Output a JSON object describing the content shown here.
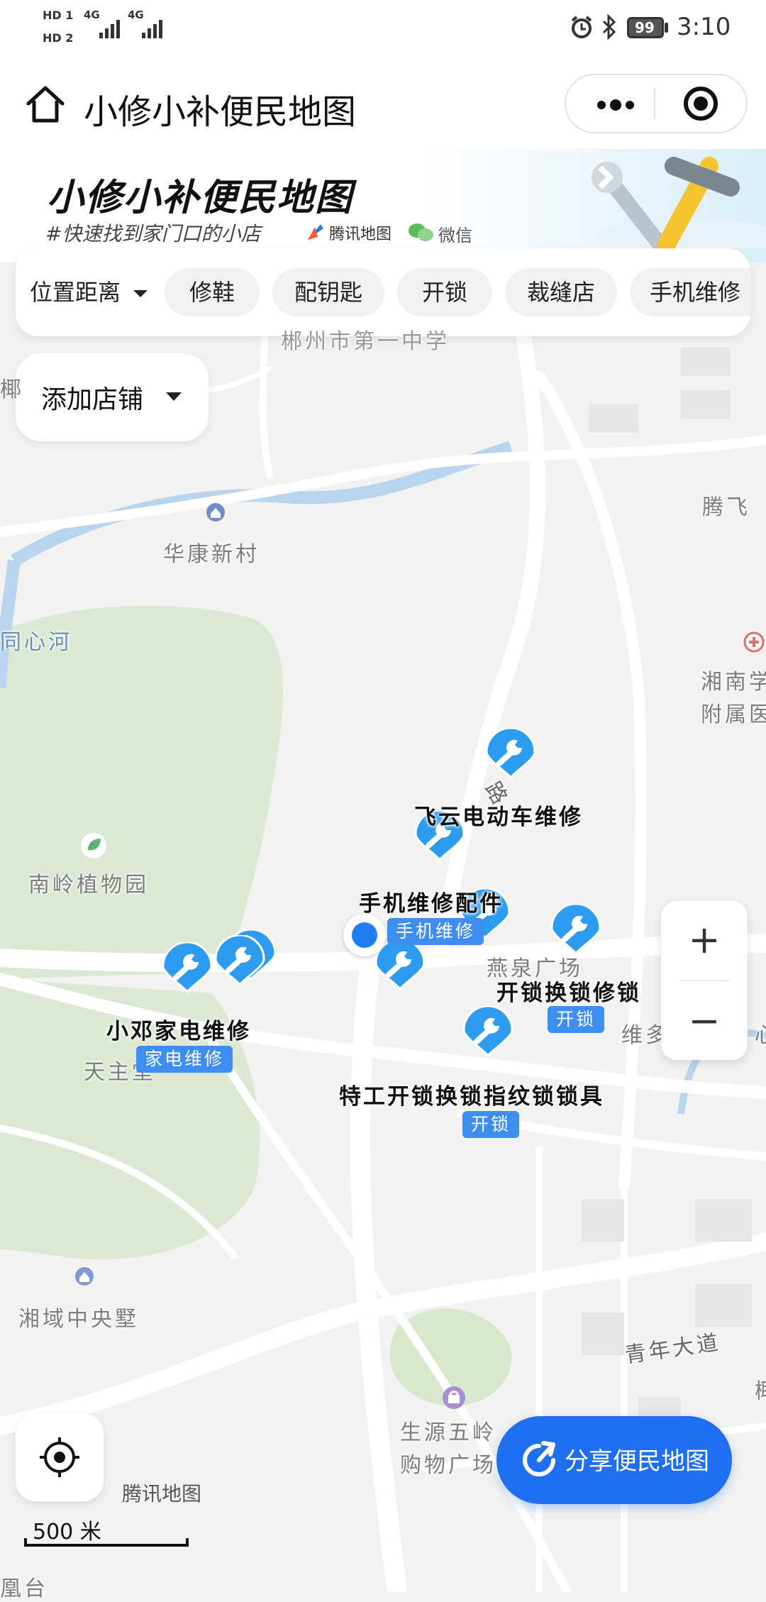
{
  "status_bar": {
    "sim1": "HD 1",
    "sim2": "HD 2",
    "network1": "4G",
    "network2": "4G",
    "battery": "99",
    "time": "3:10"
  },
  "title_bar": {
    "title": "小修小补便民地图"
  },
  "banner": {
    "title": "小修小补便民地图",
    "subtitle": "#快速找到家门口的小店",
    "partner1": "腾讯地图",
    "partner2": "微信"
  },
  "filters": {
    "distance": "位置距离",
    "chips": [
      "修鞋",
      "配钥匙",
      "开锁",
      "裁缝店",
      "手机维修"
    ]
  },
  "add_store": "添加店铺",
  "map_labels": {
    "school": "郴州市第一中学",
    "village": "华康新村",
    "river": "同心河",
    "garden": "南岭植物园",
    "tengfei": "腾飞",
    "hospital_1": "湘南学",
    "hospital_2": "附属医",
    "yanquan": "燕泉广场",
    "weiduo": "维多",
    "tianzhu": "天主堂",
    "xiangyu": "湘域中央墅",
    "qingnian": "青年大道",
    "mall_1": "生源五岭",
    "mall_2": "购物广场",
    "road": "路",
    "edge_l": "椰",
    "edge_r": "心",
    "edge_bl": "凰台",
    "edge_r2": "椰"
  },
  "shops": {
    "feiyun": "飞云电动车维修",
    "phone_parts": "手机维修配件",
    "phone_tag": "手机维修",
    "lock": "开锁换锁修锁",
    "lock_tag": "开锁",
    "xiaodeng": "小邓家电维修",
    "xiaodeng_tag": "家电维修",
    "tegong": "特工开锁换锁指纹锁锁具",
    "tegong_tag": "开锁"
  },
  "zoom": {
    "in": "+",
    "out": "−"
  },
  "map_brand": "腾讯地图",
  "scale": "500 米",
  "share_button": "分享便民地图",
  "icons": [
    "home-icon",
    "more-icon",
    "close-mini-icon",
    "dropdown-icon",
    "wrench-pin-icon",
    "locate-icon",
    "share-icon",
    "current-location-icon"
  ],
  "colors": {
    "accent": "#1f6ff0",
    "tag": "#3d8ef0",
    "pin": "#2d9cf0"
  }
}
